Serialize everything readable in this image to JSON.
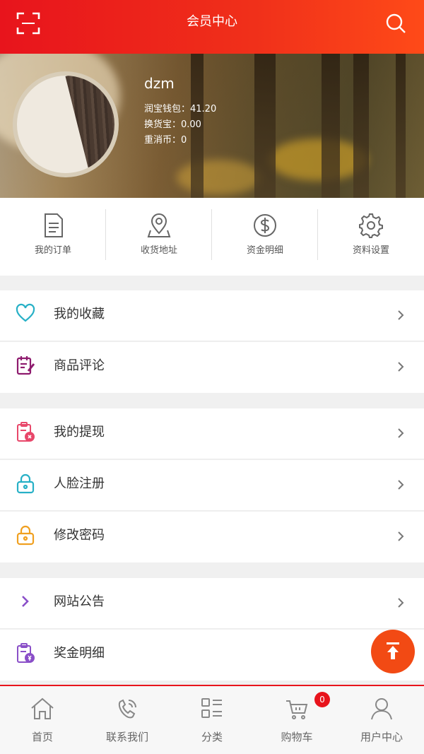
{
  "header": {
    "title": "会员中心",
    "left_icon": "scan-icon",
    "right_icon": "search-icon",
    "colors": {
      "bar_start": "#e8141c",
      "bar_end": "#ff4a18"
    }
  },
  "profile": {
    "username": "dzm",
    "stats": [
      "润宝钱包：41.20",
      "换货宝：0.00",
      "重消币：0"
    ]
  },
  "quick_actions": [
    {
      "label": "我的订单",
      "icon": "document-icon"
    },
    {
      "label": "收货地址",
      "icon": "location-pin-icon"
    },
    {
      "label": "资金明细",
      "icon": "dollar-coin-icon"
    },
    {
      "label": "资料设置",
      "icon": "gear-icon"
    }
  ],
  "menu_groups": [
    [
      {
        "label": "我的收藏",
        "icon": "heart-icon",
        "color": "#27b0c6"
      },
      {
        "label": "商品评论",
        "icon": "comment-edit-icon",
        "color": "#8e1b6e"
      }
    ],
    [
      {
        "label": "我的提现",
        "icon": "withdraw-clipboard-icon",
        "color": "#e8476a"
      },
      {
        "label": "人脸注册",
        "icon": "lock-icon",
        "color": "#27b0c6"
      },
      {
        "label": "修改密码",
        "icon": "lock-icon",
        "color": "#f0a020"
      }
    ],
    [
      {
        "label": "网站公告",
        "icon": "chevron-right-icon",
        "color": "#8a4fc8"
      },
      {
        "label": "奖金明细",
        "icon": "bonus-clipboard-icon",
        "color": "#8a4fc8"
      }
    ]
  ],
  "fab": {
    "icon": "back-to-top-icon",
    "color": "#f24a14"
  },
  "tabbar": {
    "items": [
      {
        "label": "首页",
        "icon": "home-icon"
      },
      {
        "label": "联系我们",
        "icon": "phone-icon"
      },
      {
        "label": "分类",
        "icon": "category-icon"
      },
      {
        "label": "购物车",
        "icon": "cart-icon"
      },
      {
        "label": "用户中心",
        "icon": "user-icon"
      }
    ],
    "cart_badge": "0"
  }
}
